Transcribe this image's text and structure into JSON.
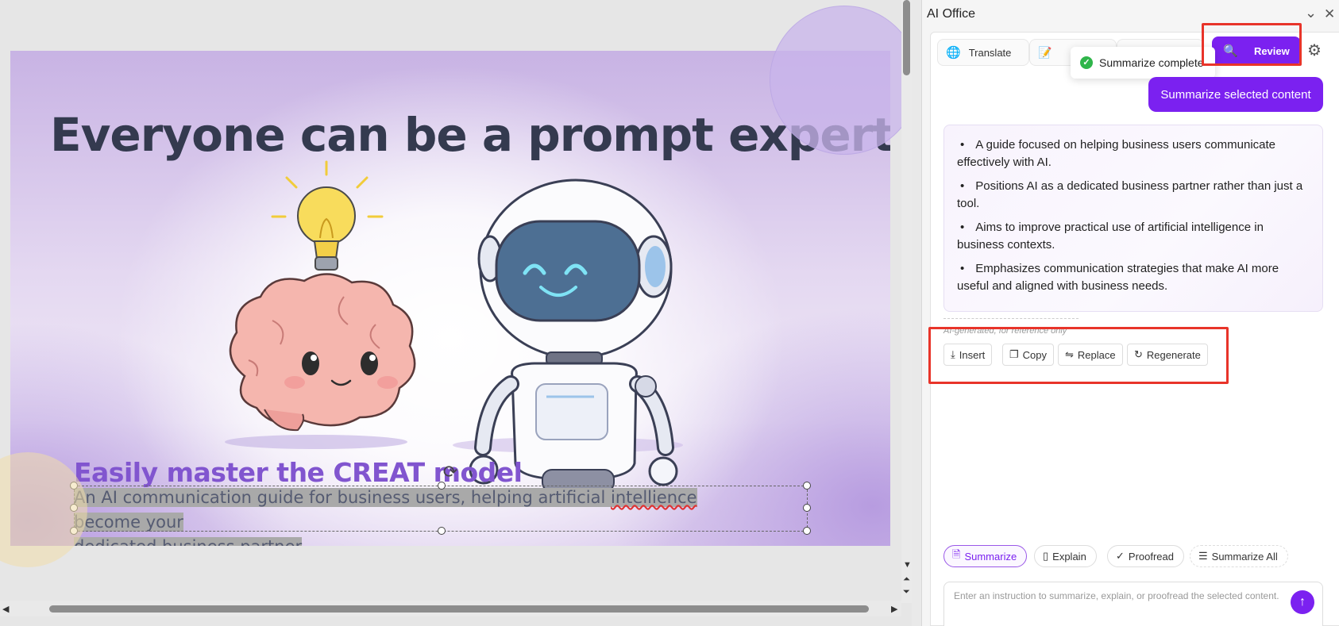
{
  "slide": {
    "title": "Everyone can be a prompt expert",
    "subtitle": "Easily master the CREAT model",
    "body_line1_pre": "An AI communication guide for business users, helping artificial ",
    "body_word_misspelled": "intellience",
    "body_line1_post": " become your",
    "body_line2": "dedicated business partner"
  },
  "panel": {
    "title": "AI Office",
    "collapse_icon": "chevron-down-icon",
    "close_icon": "close-icon",
    "tabs": [
      {
        "label": "Translate",
        "icon": "globe-icon"
      },
      {
        "label": "",
        "icon": "document-icon"
      },
      {
        "label": "",
        "icon": "sparkle-icon"
      }
    ],
    "review_label": "Review",
    "toast": "Summarize complete",
    "user_message": "Summarize selected content",
    "summary": [
      "A guide focused on helping business users communicate effectively with AI.",
      "Positions AI as a dedicated business partner rather than just a tool.",
      "Aims to improve practical use of artificial intelligence in business contexts.",
      "Emphasizes communication strategies that make AI more useful and aligned with business needs."
    ],
    "ai_note": "AI-generated, for reference only",
    "actions": {
      "insert": "Insert",
      "copy": "Copy",
      "replace": "Replace",
      "regenerate": "Regenerate"
    },
    "quick_chips": {
      "summarize": "Summarize",
      "explain": "Explain",
      "proofread": "Proofread",
      "summarize_all": "Summarize All"
    },
    "input_placeholder": "Enter an instruction to summarize, explain, or proofread the selected content."
  },
  "colors": {
    "accent": "#7b21f0",
    "highlight_box": "#e8342a",
    "slide_title": "#343a4f",
    "slide_subtitle": "#8155cf"
  }
}
